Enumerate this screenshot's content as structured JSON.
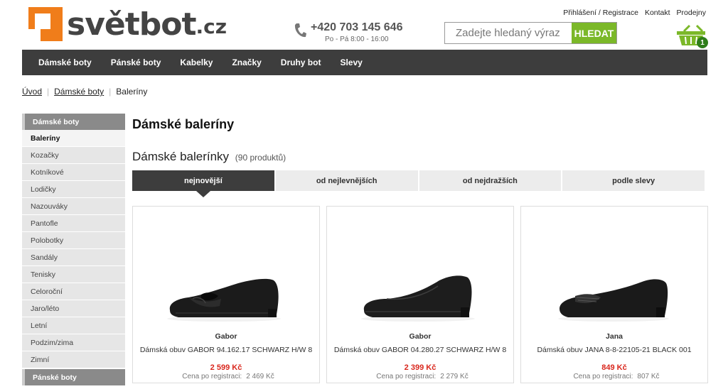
{
  "header": {
    "logo": {
      "name": "světbot",
      "tld": ".cz",
      "color": "#f07d1a"
    },
    "phone": {
      "number": "+420 703 145 646",
      "hours": "Po - Pá 8:00 - 16:00",
      "icon": "phone-icon"
    },
    "search": {
      "placeholder": "Zadejte hledaný výraz",
      "button": "HLEDAT",
      "button_color": "#7bb829"
    },
    "toplinks": [
      "Přihlášení / Registrace",
      "Kontakt",
      "Prodejny"
    ],
    "cart": {
      "icon": "basket-icon",
      "count": "1",
      "color": "#7bb829"
    }
  },
  "nav": [
    "Dámské boty",
    "Pánské boty",
    "Kabelky",
    "Značky",
    "Druhy bot",
    "Slevy"
  ],
  "breadcrumb": [
    "Úvod",
    "Dámské boty",
    "Baleríny"
  ],
  "sidebar": {
    "section": "Dámské boty",
    "items": [
      "Baleríny",
      "Kozačky",
      "Kotníkové",
      "Lodičky",
      "Nazouváky",
      "Pantofle",
      "Polobotky",
      "Sandály",
      "Tenisky",
      "Celoroční",
      "Jaro/léto",
      "Letní",
      "Podzim/zima",
      "Zimní"
    ],
    "active": "Baleríny",
    "section2": "Pánské boty"
  },
  "main": {
    "title": "Dámské baleríny",
    "subtitle": "Dámské balerínky",
    "count": "(90 produktů)",
    "sort_tabs": [
      "nejnovější",
      "od nejlevnějších",
      "od nejdražších",
      "podle slevy"
    ],
    "active_sort": "nejnovější"
  },
  "products": [
    {
      "brand": "Gabor",
      "name": "Dámská obuv GABOR 94.162.17 SCHWARZ H/W 8",
      "price": "2 599 Kč",
      "reg_label": "Cena po registraci:",
      "reg_price": "2 469 Kč"
    },
    {
      "brand": "Gabor",
      "name": "Dámská obuv GABOR 04.280.27 SCHWARZ H/W 8",
      "price": "2 399 Kč",
      "reg_label": "Cena po registraci:",
      "reg_price": "2 279 Kč"
    },
    {
      "brand": "Jana",
      "name": "Dámská obuv JANA 8-8-22105-21 BLACK 001",
      "price": "849 Kč",
      "reg_label": "Cena po registraci:",
      "reg_price": "807 Kč"
    }
  ]
}
